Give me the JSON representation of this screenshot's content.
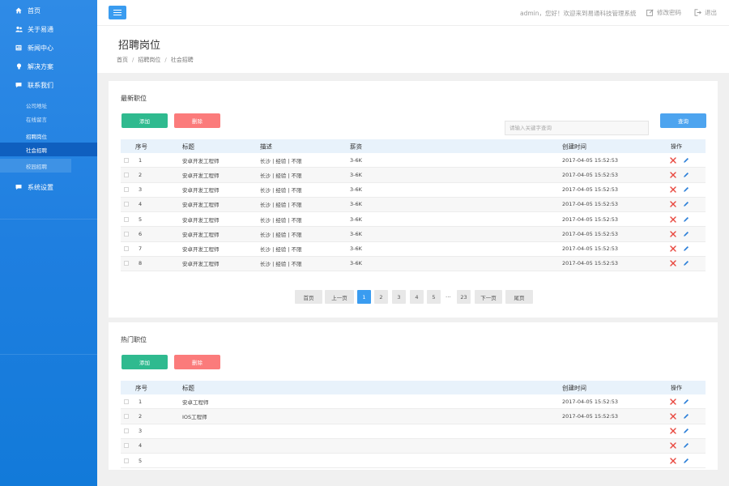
{
  "sidebar": {
    "items": [
      {
        "label": "首页",
        "icon": "home-icon"
      },
      {
        "label": "关于易通",
        "icon": "users-icon"
      },
      {
        "label": "新闻中心",
        "icon": "newspaper-icon"
      },
      {
        "label": "解决方案",
        "icon": "bulb-icon"
      },
      {
        "label": "联系我们",
        "icon": "chat-icon"
      }
    ],
    "sub_items": [
      "公司地址",
      "在线留言",
      "招聘岗位",
      "社会招聘",
      "校园招聘"
    ],
    "settings": {
      "label": "系统设置",
      "icon": "chat-icon"
    }
  },
  "topbar": {
    "welcome": "admin，您好！欢迎来到易通科技管理系统",
    "change_password": "修改密码",
    "logout": "退出"
  },
  "header": {
    "title": "招聘岗位",
    "breadcrumb": [
      "首页",
      "招聘岗位",
      "社会招聘"
    ]
  },
  "latest": {
    "title": "最新职位",
    "add_label": "添加",
    "delete_label": "删除",
    "search_placeholder": "请输入关键字查询",
    "query_label": "查询",
    "columns": {
      "no": "序号",
      "title": "标题",
      "desc": "描述",
      "salary": "薪资",
      "created": "创建时间",
      "ops": "操作"
    },
    "rows": [
      {
        "no": "1",
        "title": "安卓开发工程师",
        "desc": "长沙 | 经验 | 不限",
        "salary": "3-6K",
        "created": "2017-04-05 15:52:53"
      },
      {
        "no": "2",
        "title": "安卓开发工程师",
        "desc": "长沙 | 经验 | 不限",
        "salary": "3-6K",
        "created": "2017-04-05 15:52:53"
      },
      {
        "no": "3",
        "title": "安卓开发工程师",
        "desc": "长沙 | 经验 | 不限",
        "salary": "3-6K",
        "created": "2017-04-05 15:52:53"
      },
      {
        "no": "4",
        "title": "安卓开发工程师",
        "desc": "长沙 | 经验 | 不限",
        "salary": "3-6K",
        "created": "2017-04-05 15:52:53"
      },
      {
        "no": "5",
        "title": "安卓开发工程师",
        "desc": "长沙 | 经验 | 不限",
        "salary": "3-6K",
        "created": "2017-04-05 15:52:53"
      },
      {
        "no": "6",
        "title": "安卓开发工程师",
        "desc": "长沙 | 经验 | 不限",
        "salary": "3-6K",
        "created": "2017-04-05 15:52:53"
      },
      {
        "no": "7",
        "title": "安卓开发工程师",
        "desc": "长沙 | 经验 | 不限",
        "salary": "3-6K",
        "created": "2017-04-05 15:52:53"
      },
      {
        "no": "8",
        "title": "安卓开发工程师",
        "desc": "长沙 | 经验 | 不限",
        "salary": "3-6K",
        "created": "2017-04-05 15:52:53"
      }
    ],
    "pagination": {
      "first": "首页",
      "prev": "上一页",
      "pages": [
        "1",
        "2",
        "3",
        "4",
        "5"
      ],
      "current": "1",
      "ellipsis": "...",
      "last_page": "23",
      "next": "下一页",
      "last": "尾页"
    }
  },
  "hot": {
    "title": "热门职位",
    "add_label": "添加",
    "delete_label": "删除",
    "columns": {
      "no": "序号",
      "title": "标题",
      "created": "创建时间",
      "ops": "操作"
    },
    "rows": [
      {
        "no": "1",
        "title": "安卓工程师",
        "created": "2017-04-05 15:52:53"
      },
      {
        "no": "2",
        "title": "IOS工程师",
        "created": "2017-04-05 15:52:53"
      },
      {
        "no": "3",
        "title": "",
        "created": ""
      },
      {
        "no": "4",
        "title": "",
        "created": ""
      },
      {
        "no": "5",
        "title": "",
        "created": ""
      }
    ]
  },
  "colors": {
    "sidebar": "#1f7fe0",
    "accent": "#3a9cf0",
    "add": "#2fba8f",
    "delete": "#fb7b7b",
    "query": "#4da4ef"
  }
}
